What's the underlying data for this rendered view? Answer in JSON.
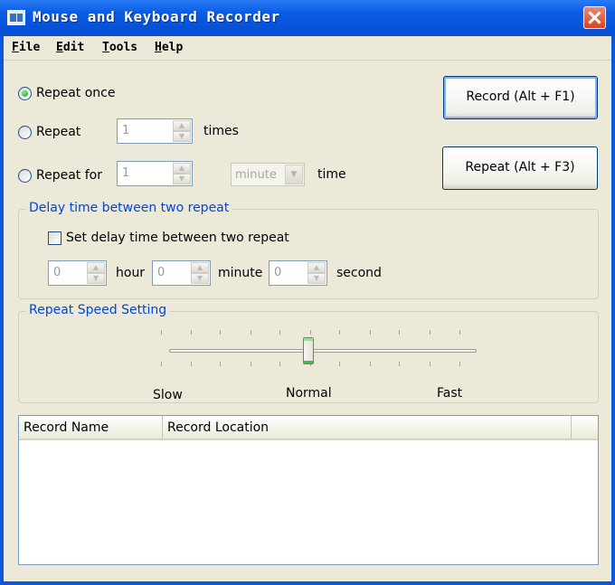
{
  "window": {
    "title": "Mouse and Keyboard Recorder"
  },
  "menu": {
    "items": [
      "File",
      "Edit",
      "Tools",
      "Help"
    ]
  },
  "repeat": {
    "once_label": "Repeat once",
    "repeat_label": "Repeat",
    "repeat_count": "1",
    "times_label": "times",
    "repeat_for_label": "Repeat for",
    "repeat_for_value": "1",
    "unit_selected": "minute",
    "time_label": "time",
    "selected_option": "once"
  },
  "buttons": {
    "record": "Record (Alt + F1)",
    "repeat": "Repeat (Alt + F3)"
  },
  "delay": {
    "group_title": "Delay time between two repeat",
    "checkbox_label": "Set delay time between two repeat",
    "hour_value": "0",
    "hour_label": "hour",
    "minute_value": "0",
    "minute_label": "minute",
    "second_value": "0",
    "second_label": "second"
  },
  "speed": {
    "group_title": "Repeat Speed Setting",
    "slow_label": "Slow",
    "normal_label": "Normal",
    "fast_label": "Fast",
    "level_fraction": 0.5
  },
  "records": {
    "columns": [
      "Record Name",
      "Record Location"
    ],
    "rows": []
  }
}
